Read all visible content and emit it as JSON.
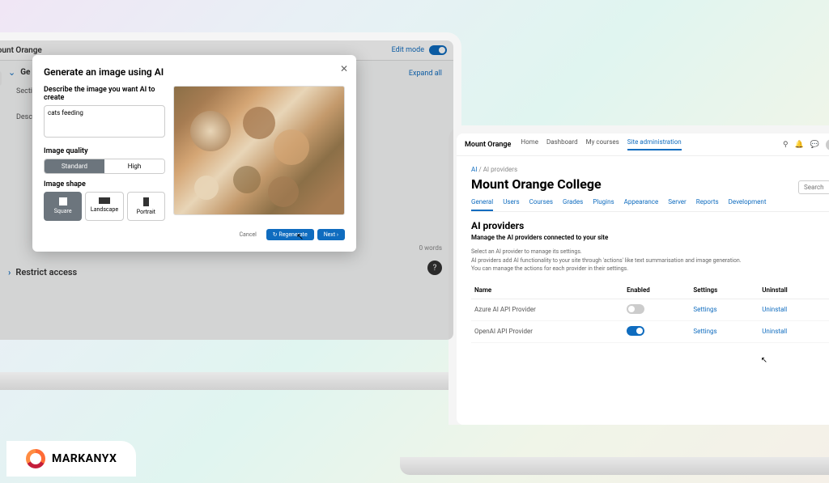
{
  "logo": "MARKANYX",
  "left": {
    "site": "Mount Orange",
    "edit_mode": "Edit mode",
    "expand": "Expand all",
    "section_prefix": "Section",
    "section_gen": "Ge",
    "description": "Descript",
    "words": "0 words",
    "help": "?",
    "restrict": "Restrict access",
    "modal": {
      "title": "Generate an image using AI",
      "close": "✕",
      "describe_label": "Describe the image you want AI to create",
      "describe_value": "cats feeding",
      "quality_label": "Image quality",
      "quality_standard": "Standard",
      "quality_high": "High",
      "shape_label": "Image shape",
      "shape_square": "Square",
      "shape_landscape": "Landscape",
      "shape_portrait": "Portrait",
      "cancel": "Cancel",
      "regenerate": "↻ Regenerate",
      "next": "Next ›"
    }
  },
  "right": {
    "site": "Mount Orange",
    "nav": {
      "home": "Home",
      "dashboard": "Dashboard",
      "courses": "My courses",
      "admin": "Site administration"
    },
    "breadcrumb_ai": "AI",
    "breadcrumb_sep": " / ",
    "breadcrumb_providers": "AI providers",
    "title": "Mount Orange College",
    "search": "Search",
    "subtabs": {
      "general": "General",
      "users": "Users",
      "courses": "Courses",
      "grades": "Grades",
      "plugins": "Plugins",
      "appearance": "Appearance",
      "server": "Server",
      "reports": "Reports",
      "development": "Development"
    },
    "sec_title": "AI providers",
    "sec_sub": "Manage the AI providers connected to your site",
    "sec_desc1": "Select an AI provider to manage its settings.",
    "sec_desc2": "AI providers add AI functionality to your site through 'actions' like text summarisation and image generation.",
    "sec_desc3": "You can manage the actions for each provider in their settings.",
    "th": {
      "name": "Name",
      "enabled": "Enabled",
      "settings": "Settings",
      "uninstall": "Uninstall"
    },
    "rows": [
      {
        "name": "Azure AI API Provider",
        "enabled": false,
        "settings": "Settings",
        "uninstall": "Uninstall"
      },
      {
        "name": "OpenAI API Provider",
        "enabled": true,
        "settings": "Settings",
        "uninstall": "Uninstall"
      }
    ]
  }
}
